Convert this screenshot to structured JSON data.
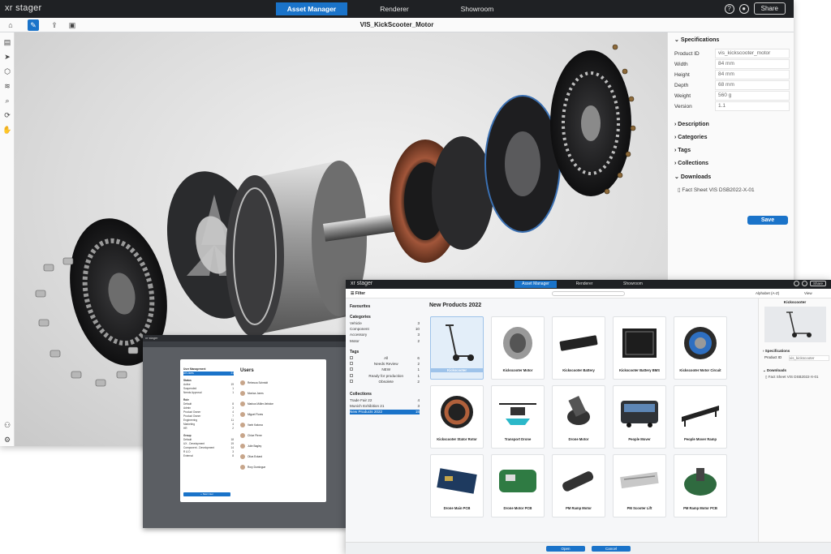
{
  "main": {
    "brand": "xr stager",
    "nav_tabs": [
      "Asset Manager",
      "Renderer",
      "Showroom"
    ],
    "share_label": "Share",
    "document_title": "VIS_KickScooter_Motor",
    "specifications": {
      "heading": "Specifications",
      "rows": [
        {
          "key": "Product ID",
          "value": "vis_kickscooter_motor"
        },
        {
          "key": "Width",
          "value": "84 mm"
        },
        {
          "key": "Height",
          "value": "84 mm"
        },
        {
          "key": "Depth",
          "value": "68 mm"
        },
        {
          "key": "Weight",
          "value": "560 g"
        },
        {
          "key": "Version",
          "value": "1.1"
        }
      ]
    },
    "sections": [
      "Description",
      "Categories",
      "Tags",
      "Collections",
      "Downloads"
    ],
    "download_file": "Fact Sheet VIS DSB2022-X-01",
    "save_label": "Save"
  },
  "users_window": {
    "brand": "xr stager",
    "title": "Users",
    "left_items": [
      {
        "label": "User Management",
        "type": "h"
      },
      {
        "label": "All Users",
        "type": "sel",
        "count": "21"
      },
      {
        "label": "Status",
        "type": "h"
      },
      {
        "label": "Active",
        "type": "r",
        "count": "19"
      },
      {
        "label": "Suspended",
        "type": "r",
        "count": "1"
      },
      {
        "label": "Needs Approval",
        "type": "r",
        "count": "1"
      },
      {
        "label": "Role",
        "type": "h"
      },
      {
        "label": "Default",
        "type": "r",
        "count": "8"
      },
      {
        "label": "Admin",
        "type": "r",
        "count": "3"
      },
      {
        "label": "Product Owner",
        "type": "r",
        "count": "4"
      },
      {
        "label": "Product Owner",
        "type": "r",
        "count": "7"
      },
      {
        "label": "Engineering",
        "type": "r",
        "count": "11"
      },
      {
        "label": "Marketing",
        "type": "r",
        "count": "4"
      },
      {
        "label": "HR",
        "type": "r",
        "count": "2"
      },
      {
        "label": "Group",
        "type": "h"
      },
      {
        "label": "Default",
        "type": "r",
        "count": "18"
      },
      {
        "label": "UX - Development",
        "type": "r",
        "count": "19"
      },
      {
        "label": "Component - Development",
        "type": "r",
        "count": "14"
      },
      {
        "label": "R & D",
        "type": "r",
        "count": "3"
      },
      {
        "label": "External",
        "type": "r",
        "count": "8"
      }
    ],
    "users": [
      "Rebecca Schmidt",
      "Monica Jones",
      "Markus Müller-Ilebicke",
      "Miguel Flores",
      "Vanh Kakova",
      "Chloe Pierre",
      "Julie Bagley",
      "Oliva Eckard",
      "Rory Domingue"
    ],
    "new_user_label": "+ New User"
  },
  "library": {
    "brand": "xr stager",
    "nav_tabs": [
      "Asset Manager",
      "Renderer",
      "Showroom"
    ],
    "share_label": "Share",
    "filter_label": "Filter",
    "sort_label": "Alphabet (A-Z)",
    "view_label": "View",
    "sidebar": {
      "favourites": "Favourites",
      "categories_heading": "Categories",
      "categories": [
        {
          "label": "Vehicle",
          "count": "3"
        },
        {
          "label": "Component",
          "count": "10"
        },
        {
          "label": "Accessory",
          "count": "3"
        },
        {
          "label": "Motor",
          "count": "2"
        }
      ],
      "tags_heading": "Tags",
      "tags": [
        {
          "label": "All",
          "count": "6"
        },
        {
          "label": "Needs Review",
          "count": "2"
        },
        {
          "label": "NEW",
          "count": "1"
        },
        {
          "label": "Ready for production",
          "count": "1"
        },
        {
          "label": "Obsolete",
          "count": "2"
        }
      ],
      "collections_heading": "Collections",
      "collections": [
        {
          "label": "Trade Fair 22",
          "count": "4"
        },
        {
          "label": "Munich Exhibition 21",
          "count": "3"
        },
        {
          "label": "New Products 2022",
          "count": "15"
        }
      ]
    },
    "grid_title": "New Products 2022",
    "tiles": [
      "Kickscooter",
      "Kickscooter Motor",
      "Kickscooter Battery",
      "Kickscooter Battery BMS",
      "Kickscooter Motor Circuit",
      "Kickscooter Stator Rotor",
      "Transport Drone",
      "Drone Motor",
      "People Mover",
      "People Mover Ramp",
      "Drone Main PCB",
      "Drone Motor PCB",
      "PM Ramp Motor",
      "PM Scooter Lift",
      "PM Ramp Motor PCB"
    ],
    "right_panel": {
      "title": "Kickscooter",
      "specifications": "Specifications",
      "product_id_key": "Product ID",
      "product_id_value": "vis_kickscooter",
      "downloads": "Downloads",
      "download_file": "Fact Sheet VIS DSB2022-X-01"
    },
    "open_label": "Open",
    "cancel_label": "Cancel"
  }
}
